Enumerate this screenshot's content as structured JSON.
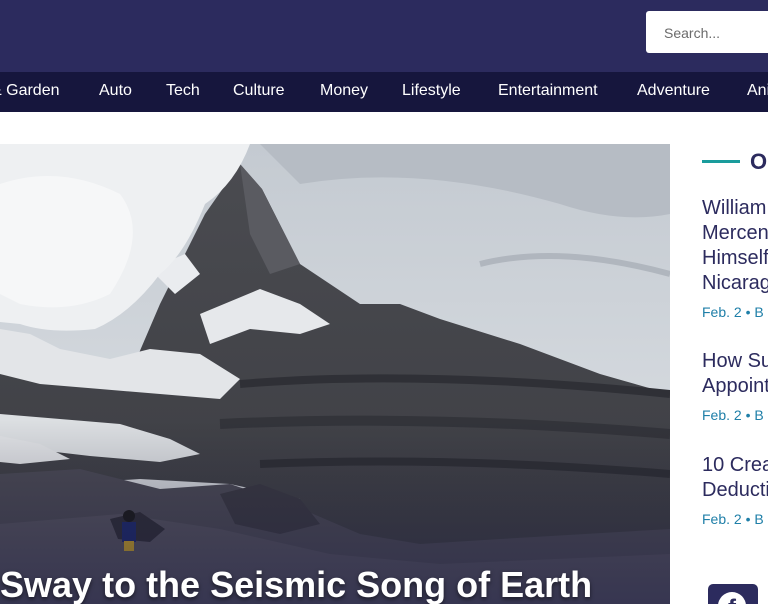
{
  "header": {
    "search": {
      "placeholder": "Search..."
    },
    "nav": [
      "& Garden",
      "Auto",
      "Tech",
      "Culture",
      "Money",
      "Lifestyle",
      "Entertainment",
      "Adventure",
      "Ani"
    ]
  },
  "hero": {
    "title": "s Sway to the Seismic Song of Earth"
  },
  "sidebar": {
    "heading": "O",
    "articles": [
      {
        "title_lines": [
          "William",
          "Mercen",
          "Himself",
          "Nicarag"
        ],
        "date": "Feb. 2",
        "author": "• B"
      },
      {
        "title_lines": [
          "How Su",
          "Appoint"
        ],
        "date": "Feb. 2",
        "author": "• B"
      },
      {
        "title_lines": [
          "10 Crea",
          "Deducti"
        ],
        "date": "Feb. 2",
        "author": "• B"
      }
    ],
    "social_icon": "facebook-icon",
    "social_glyph": "f"
  },
  "colors": {
    "header_bg": "#2c2b5e",
    "nav_bg": "#16163d",
    "accent": "#1a9c9c",
    "link": "#2c2b5e",
    "meta": "#1f7fa8"
  }
}
